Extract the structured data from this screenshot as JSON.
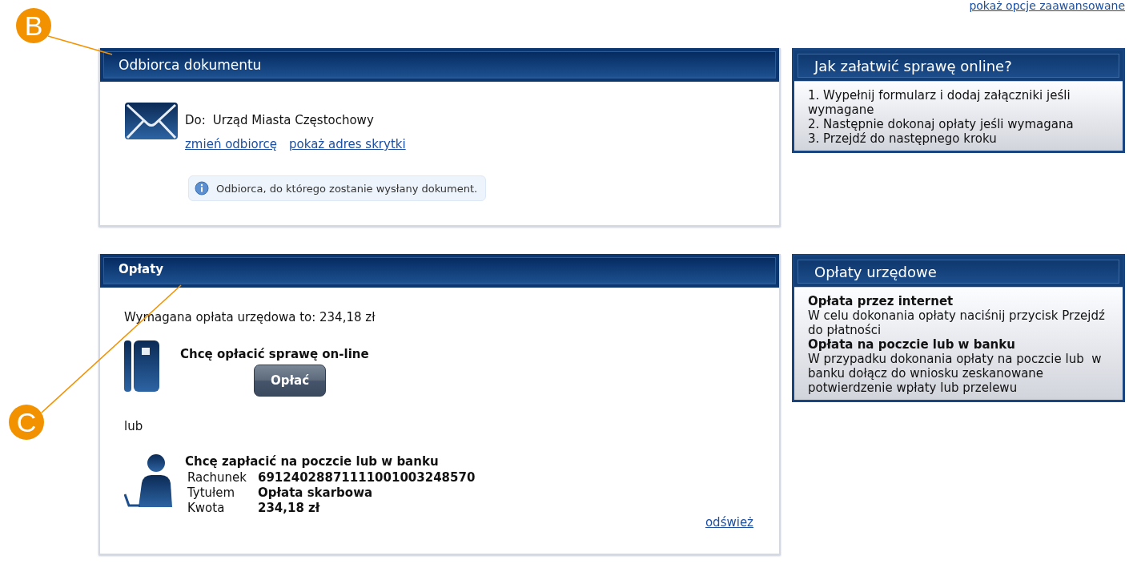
{
  "top_link": "pokaż opcje zaawansowane",
  "recipient_panel": {
    "title": "Odbiorca dokumentu",
    "recipient_label": "Do:",
    "recipient": "Urząd Miasta Częstochowy",
    "links": [
      "zmień odbiorcę",
      "pokaż adres skrytki"
    ],
    "info": "Odbiorca, do którego zostanie wysłany dokument."
  },
  "fees_panel": {
    "title": "Opłaty",
    "required_fee": "Wymagana opłata urzędowa to: 234,18 zł",
    "online": {
      "heading": "Chcę opłacić sprawę on-line",
      "button": "Opłać"
    },
    "separator": "lub",
    "offline": {
      "heading": "Chcę zapłacić na poczcie lub w banku",
      "details": [
        {
          "label": "Rachunek",
          "value": "69124028871111001003248570"
        },
        {
          "label": "Tytułem",
          "value": "Opłata skarbowa"
        },
        {
          "label": "Kwota",
          "value": "234,18 zł"
        }
      ]
    },
    "refresh_link": "odśwież"
  },
  "help_boxes": [
    {
      "title": "Jak załatwić sprawę online?",
      "lines": [
        {
          "kind": "plain",
          "text": "1. Wypełnij formularz i dodaj załączniki jeśli wymagane"
        },
        {
          "kind": "plain",
          "text": "2. Następnie dokonaj opłaty jeśli wymagana"
        },
        {
          "kind": "plain",
          "text": "3. Przejdź do następnego kroku"
        }
      ]
    },
    {
      "title": "Opłaty urzędowe",
      "lines": [
        {
          "kind": "heading",
          "text": "Opłata przez internet"
        },
        {
          "kind": "plain",
          "text": "W celu dokonania opłaty naciśnij przycisk Przejdź do płatności"
        },
        {
          "kind": "heading",
          "text": "Opłata na poczcie lub w banku"
        },
        {
          "kind": "plain",
          "text": "W przypadku dokonania opłaty na poczcie lub  w banku dołącz do wniosku zeskanowane potwierdzenie wpłaty lub przelewu"
        }
      ]
    }
  ],
  "callouts": [
    {
      "letter": "B"
    },
    {
      "letter": "C"
    }
  ]
}
